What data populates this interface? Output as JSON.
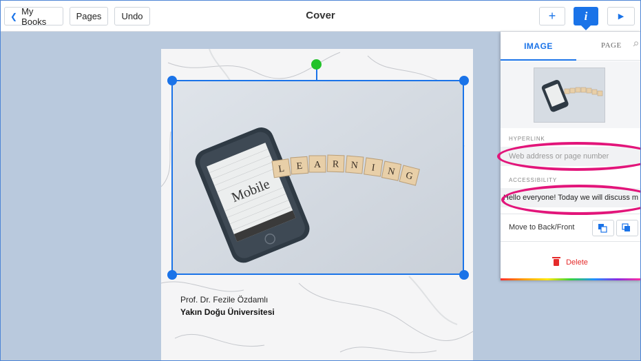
{
  "toolbar": {
    "back_label": "My Books",
    "pages_label": "Pages",
    "undo_label": "Undo",
    "title": "Cover",
    "add_icon": "plus-icon",
    "info_icon": "info-icon",
    "info_glyph": "i",
    "play_icon": "play-icon",
    "accent_color": "#1a73e8"
  },
  "page": {
    "author": "Prof. Dr. Fezile Özdamlı",
    "institution": "Yakın Doğu Üniversitesi",
    "image": {
      "phone_text": "Mobile",
      "tiles": [
        "L",
        "E",
        "A",
        "R",
        "N",
        "I",
        "N",
        "G"
      ]
    }
  },
  "panel": {
    "tabs": {
      "image": "IMAGE",
      "page": "PAGE"
    },
    "hyperlink": {
      "label": "HYPERLINK",
      "placeholder": "Web address or page number"
    },
    "accessibility": {
      "label": "ACCESSIBILITY",
      "value": "Hello everyone! Today we will discuss m"
    },
    "move_label": "Move to Back/Front",
    "delete_label": "Delete"
  }
}
